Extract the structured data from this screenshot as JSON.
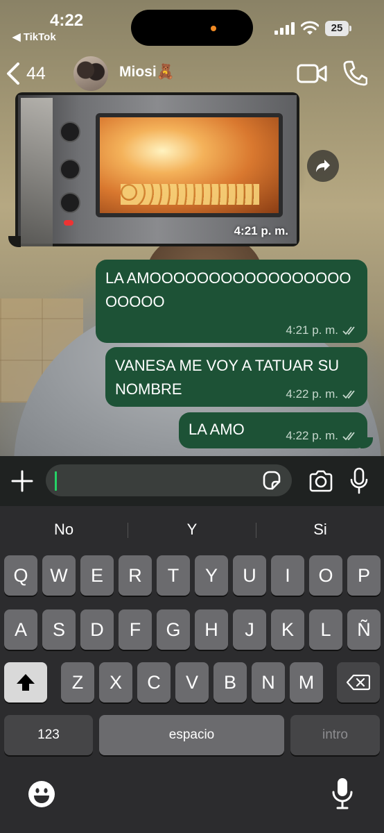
{
  "status": {
    "time": "4:22",
    "back_app": "◀ TikTok",
    "battery": "25"
  },
  "header": {
    "back_count": "44",
    "contact_name": "Miosi🧸"
  },
  "messages": [
    {
      "id": "media",
      "type": "image",
      "description_icon": "oven-photo",
      "time": "4:21 p. m."
    },
    {
      "id": "msg1",
      "text": "LA AMOOOOOOOOOOOOOOOOOOOOOO",
      "time": "4:21 p. m.",
      "status": "read"
    },
    {
      "id": "msg2",
      "text": "VANESA ME VOY A TATUAR SU NOMBRE",
      "time": "4:22 p. m.",
      "status": "read"
    },
    {
      "id": "msg3",
      "text": "LA AMO",
      "time": "4:22 p. m.",
      "status": "read"
    }
  ],
  "composer": {
    "placeholder": ""
  },
  "keyboard": {
    "suggestions": [
      "No",
      "Y",
      "Si"
    ],
    "row1": [
      "Q",
      "W",
      "E",
      "R",
      "T",
      "Y",
      "U",
      "I",
      "O",
      "P"
    ],
    "row2": [
      "A",
      "S",
      "D",
      "F",
      "G",
      "H",
      "J",
      "K",
      "L",
      "Ñ"
    ],
    "row3": [
      "Z",
      "X",
      "C",
      "V",
      "B",
      "N",
      "M"
    ],
    "numbers_label": "123",
    "space_label": "espacio",
    "return_label": "intro"
  },
  "colors": {
    "outgoing_bubble": "#1d5236",
    "caret": "#25d366",
    "keyboard_bg": "#2c2c2e"
  }
}
